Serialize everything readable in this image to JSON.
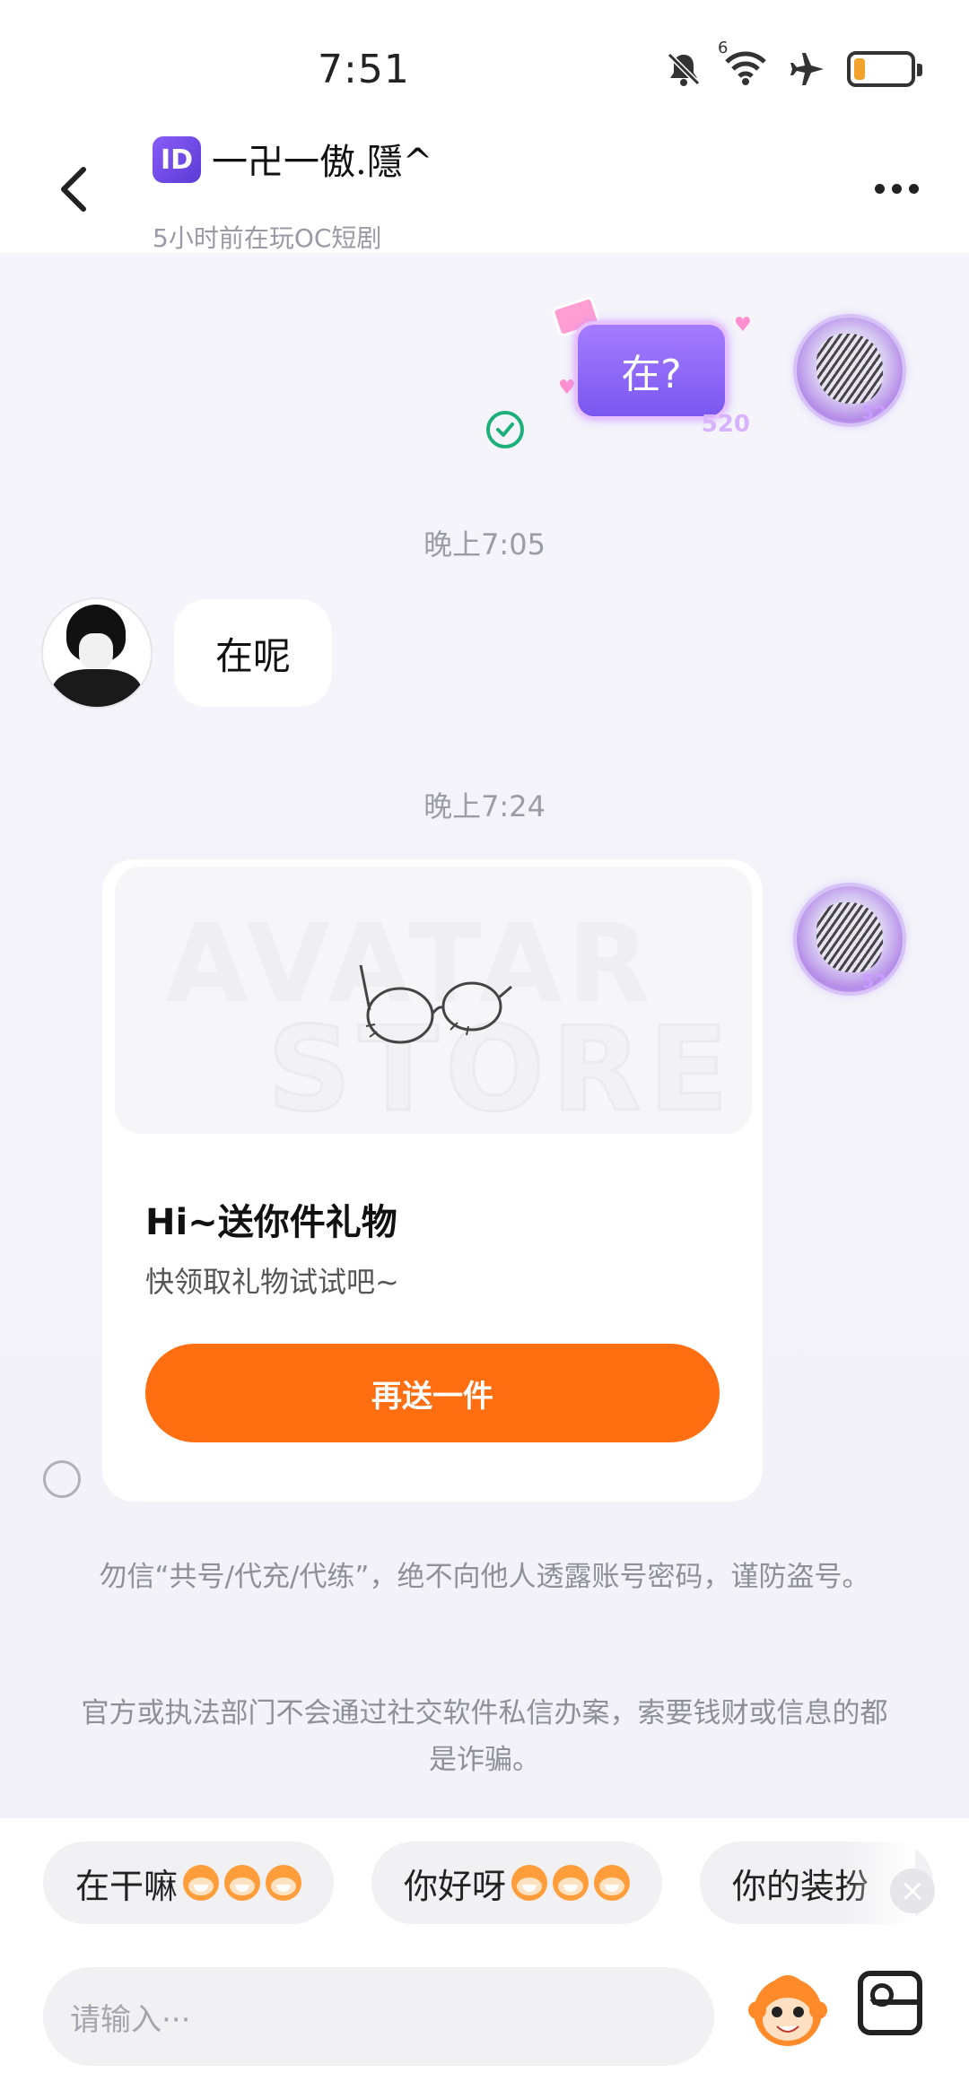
{
  "status_bar": {
    "time": "7:51",
    "signal_label": "6"
  },
  "header": {
    "id_badge": "ID",
    "contact_name": "一卍一傲.隱^",
    "contact_status": "5小时前在玩OC短剧"
  },
  "messages": {
    "self_message": "在?",
    "self_frame_tag": "520",
    "time_1": "晚上7:05",
    "friend_message": "在呢",
    "time_2": "晚上7:24",
    "gift_card": {
      "watermark_line1": "AVATAR",
      "watermark_line2": "STORE",
      "title": "Hi~送你件礼物",
      "subtitle": "快领取礼物试试吧~",
      "button_label": "再送一件"
    }
  },
  "notices": {
    "warning_1": "勿信“共号/代充/代练”，绝不向他人透露账号密码，谨防盗号。",
    "warning_2": "官方或执法部门不会通过社交软件私信办案，索要钱财或信息的都是诈骗。"
  },
  "quick_replies": [
    {
      "label": "在干嘛"
    },
    {
      "label": "你好呀"
    },
    {
      "label": "你的装扮"
    }
  ],
  "input": {
    "placeholder": "请输入···"
  },
  "colors": {
    "accent_orange": "#ff6f12",
    "read_check_green": "#1eb07a",
    "bubble_purple": "#7a57f0"
  },
  "icons": [
    "back-icon",
    "more-icon",
    "mute-icon",
    "wifi-icon",
    "airplane-icon",
    "battery-icon",
    "check-icon",
    "glasses-icon",
    "close-icon",
    "mascot-emoji-icon",
    "image-icon"
  ]
}
